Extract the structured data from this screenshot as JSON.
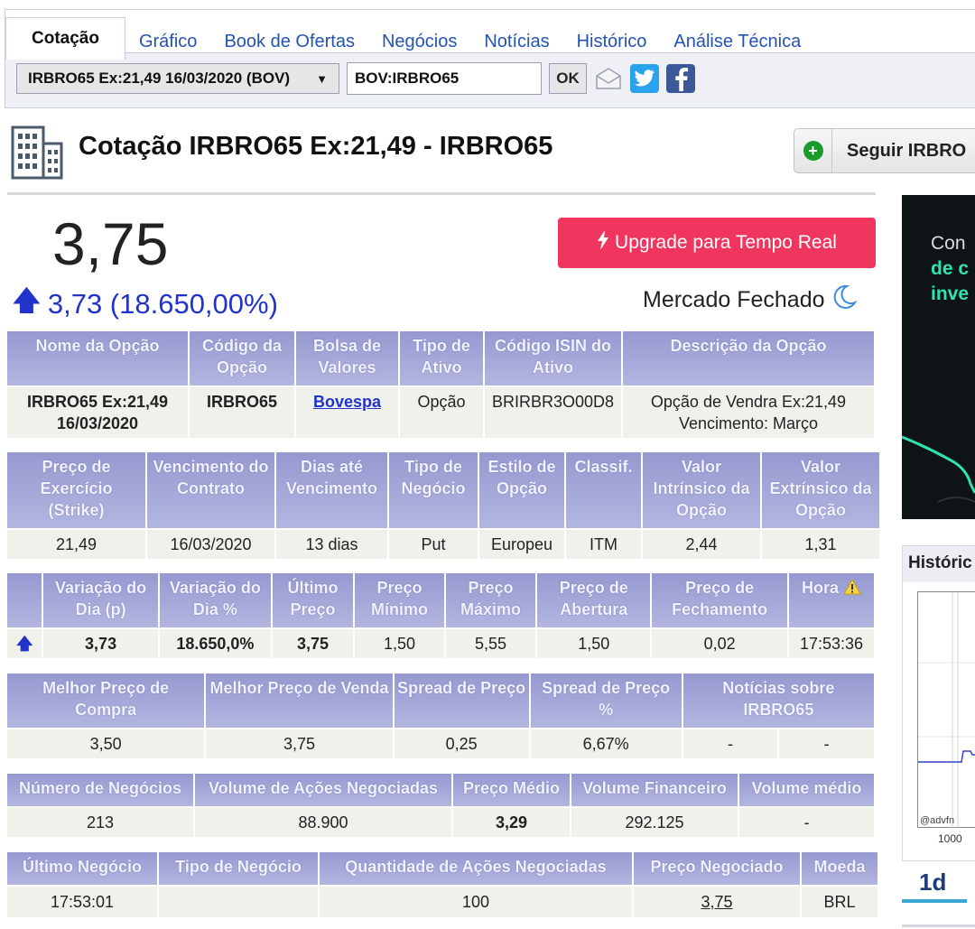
{
  "tabs": [
    {
      "label": "Cotação",
      "active": true
    },
    {
      "label": "Gráfico"
    },
    {
      "label": "Book de Ofertas"
    },
    {
      "label": "Negócios"
    },
    {
      "label": "Notícias"
    },
    {
      "label": "Histórico"
    },
    {
      "label": "Análise Técnica"
    }
  ],
  "toolbar": {
    "select_value": "IRBRO65 Ex:21,49 16/03/2020 (BOV)",
    "code_value": "BOV:IRBRO65",
    "ok_label": "OK"
  },
  "header": {
    "title": "Cotação IRBRO65 Ex:21,49 - IRBRO65",
    "follow_label": "Seguir IRBRO"
  },
  "quote": {
    "price": "3,75",
    "change": "3,73 (18.650,00%)",
    "upgrade_label": "Upgrade para Tempo Real",
    "market_status": "Mercado Fechado"
  },
  "table1": {
    "headers": [
      "Nome da Opção",
      "Código da Opção",
      "Bolsa de Valores",
      "Tipo de Ativo",
      "Código ISIN do Ativo",
      "Descrição da Opção"
    ],
    "row": [
      "IRBRO65 Ex:21,49 16/03/2020",
      "IRBRO65",
      "Bovespa",
      "Opção",
      "BRIRBR3O00D8",
      "Opção de Vendra Ex:21,49 Vencimento: Março"
    ]
  },
  "table2": {
    "headers": [
      "Preço de Exercício (Strike)",
      "Vencimento do Contrato",
      "Dias até Vencimento",
      "Tipo de Negócio",
      "Estilo de Opção",
      "Classif.",
      "Valor Intrínsico da Opção",
      "Valor Extrínsico da Opção"
    ],
    "row": [
      "21,49",
      "16/03/2020",
      "13 dias",
      "Put",
      "Europeu",
      "ITM",
      "2,44",
      "1,31"
    ]
  },
  "table3": {
    "headers": [
      "",
      "Variação do Dia (p)",
      "Variação do Dia %",
      "Último Preço",
      "Preço Mínimo",
      "Preço Máximo",
      "Preço de Abertura",
      "Preço de Fechamento",
      "Hora"
    ],
    "row": [
      "",
      "3,73",
      "18.650,0%",
      "3,75",
      "1,50",
      "5,55",
      "1,50",
      "0,02",
      "17:53:36"
    ]
  },
  "table4": {
    "headers": [
      "Melhor Preço de Compra",
      "Melhor Preço de Venda",
      "Spread de Preço",
      "Spread de Preço %",
      "Notícias sobre IRBRO65"
    ],
    "row": [
      "3,50",
      "3,75",
      "0,25",
      "6,67%",
      "-",
      "-"
    ]
  },
  "table5": {
    "headers": [
      "Número de Negócios",
      "Volume de Ações Negociadas",
      "Preço Médio",
      "Volume Financeiro",
      "Volume médio"
    ],
    "row": [
      "213",
      "88.900",
      "3,29",
      "292.125",
      "-"
    ]
  },
  "table6": {
    "headers": [
      "Último Negócio",
      "Tipo de Negócio",
      "Quantidade de Ações Negociadas",
      "Preço Negociado",
      "Moeda"
    ],
    "row": [
      "17:53:01",
      "",
      "100",
      "3,75",
      "BRL"
    ]
  },
  "ad": {
    "line1": "Con",
    "line2": "de c",
    "line3": "inve"
  },
  "history": {
    "title": "Históric",
    "watermark": "@advfn",
    "x_label": "1000",
    "period": "1d"
  },
  "colors": {
    "header_bg": "#9599d0",
    "accent_blue": "#2233cc",
    "upgrade_red": "#f0365f",
    "link_blue": "#2553b0"
  }
}
